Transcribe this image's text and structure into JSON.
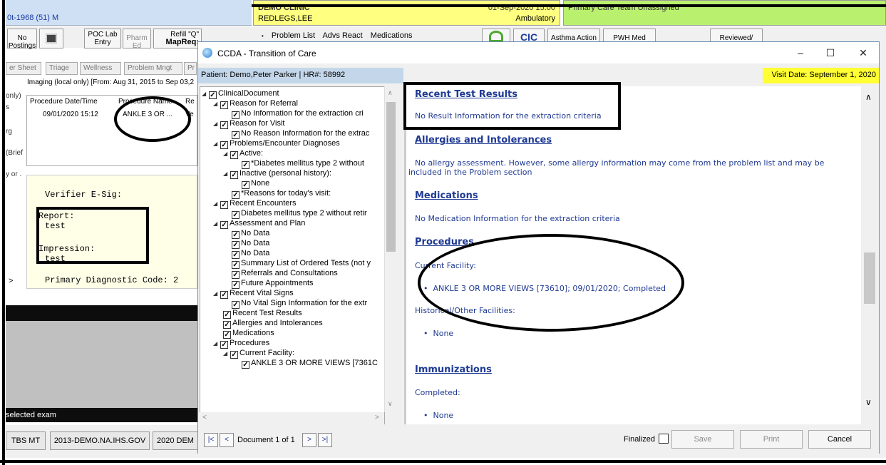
{
  "header": {
    "patient_dob": "0t-1968 (51)   M",
    "clinic": "DEMO CLINIC",
    "patient_name": "REDLEGS,LEE",
    "datetime": "01-Sep-2020 15:00",
    "location": "Ambulatory",
    "care_team": "Primary Care Team Unassigned"
  },
  "toolbar": {
    "no_postings": "No Postings",
    "poc_lab": "POC Lab Entry",
    "pharm_ed": "Pharm Ed",
    "refill": "Refill \"Q\"",
    "mapreq": "MapReq:",
    "tabs": [
      "Problem List",
      "Advs React",
      "Medications"
    ],
    "cic": "CIC",
    "asthma": "Asthma Action",
    "pwh": "PWH Med",
    "reviewed": "Reviewed/"
  },
  "bg_tabs": [
    "er Sheet",
    "Triage",
    "Wellness",
    "Problem Mngt",
    "Pr"
  ],
  "imaging": {
    "title": "Imaging (local only) [From: Aug 31, 2015 to Sep 03,2",
    "headers": [
      "Procedure Date/Time",
      "Procedure Name",
      "Re"
    ],
    "row": [
      "09/01/2020 15:12",
      "ANKLE 3 OR ...",
      "Ve"
    ]
  },
  "left_labels": [
    "only)",
    "s",
    "rg",
    "(Brief",
    "y or ."
  ],
  "report": {
    "verifier": "Verifier E-Sig:",
    "report_label": "Report:",
    "report_text": "test",
    "impression_label": "Impression:",
    "impression_text": "test",
    "diag": "Primary Diagnostic Code: 2"
  },
  "status": "selected exam",
  "taskbar": [
    "TBS MT",
    "2013-DEMO.NA.IHS.GOV",
    "2020 DEM"
  ],
  "dialog": {
    "title": "CCDA - Transition of Care",
    "patient": "Patient: Demo,Peter Parker | HR#: 58992",
    "visit_date": "Visit Date: September 1, 2020",
    "tree": [
      "ClinicalDocument",
      "Reason for Referral",
      "No  Information for the extraction cri",
      "Reason for Visit",
      "No Reason Information for the extrac",
      "Problems/Encounter Diagnoses",
      "Active:",
      "*Diabetes mellitus type 2 without",
      "Inactive (personal history):",
      "None",
      "*Reasons for today's visit:",
      "Recent Encounters",
      "Diabetes mellitus type 2 without retir",
      "Assessment and Plan",
      "No Data",
      "No Data",
      "No Data",
      "Summary List of Ordered Tests (not y",
      "Referrals and Consultations",
      "Future Appointments",
      "Recent Vital Signs",
      "No Vital Sign Information for the extr",
      "Recent Test Results",
      "Allergies and Intolerances",
      "Medications",
      "Procedures",
      "Current Facility:",
      "ANKLE 3 OR MORE VIEWS [7361C"
    ],
    "content": {
      "recent_tests_h": "Recent Test Results",
      "recent_tests_t": "No Result Information for the extraction criteria",
      "allergies_h": "Allergies and Intolerances",
      "allergies_t1": "No allergy assessment. However, some allergy information may come from the problem list and may be",
      "allergies_t2": "included in the Problem section",
      "meds_h": "Medications",
      "meds_t": "No Medication Information for the extraction criteria",
      "proc_h": "Procedures",
      "proc_current": "Current Facility:",
      "proc_item": "ANKLE 3 OR MORE VIEWS [73610]; 09/01/2020; Completed",
      "proc_hist": "Historical/Other Facilities:",
      "proc_none": "None",
      "imm_h": "Immunizations",
      "imm_completed": "Completed:",
      "imm_none": "None"
    },
    "bottom": {
      "first": "|<",
      "prev": "<",
      "document": "Document 1 of 1",
      "next": ">",
      "last": ">|",
      "finalized": "Finalized",
      "save": "Save",
      "print": "Print",
      "cancel": "Cancel"
    }
  }
}
